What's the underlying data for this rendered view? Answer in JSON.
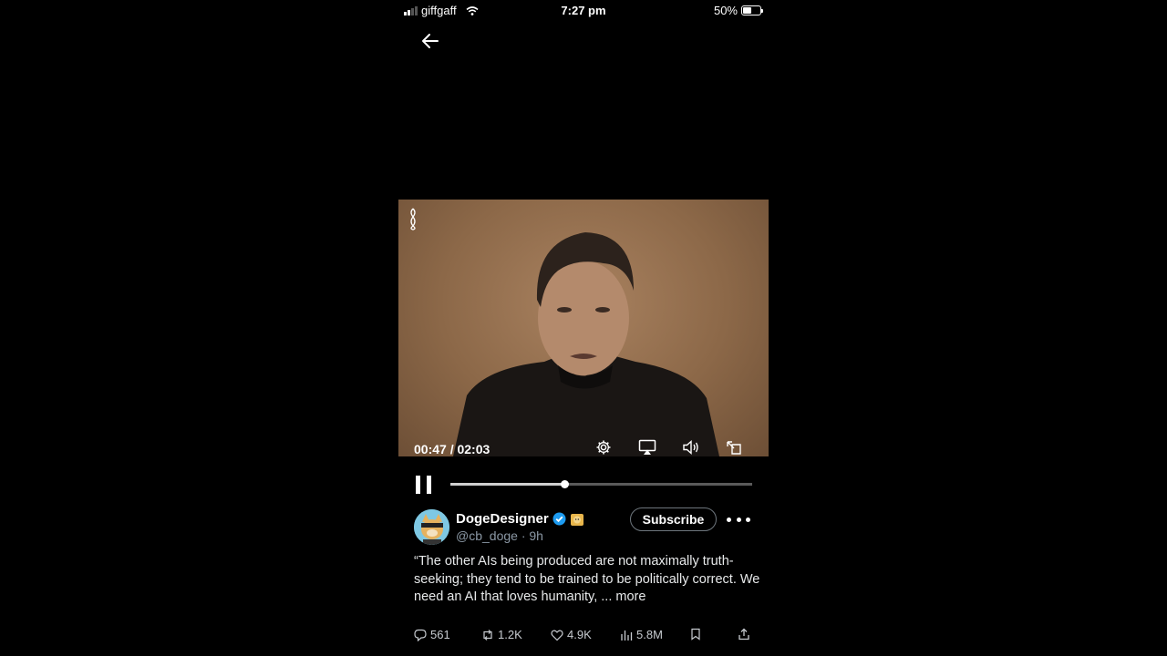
{
  "status_bar": {
    "carrier": "giffgaff",
    "time": "7:27 pm",
    "battery": "50%",
    "battery_level": 0.5
  },
  "video": {
    "current_time": "00:47",
    "separator": " / ",
    "duration": "02:03",
    "progress_fraction": 0.38,
    "controls": [
      "settings-icon",
      "airplay-icon",
      "volume-icon",
      "fullscreen-icon"
    ]
  },
  "post": {
    "author_name": "DogeDesigner",
    "handle": "@cb_doge",
    "time_ago": "9h",
    "subscribe_label": "Subscribe",
    "text": "“The other AIs being produced are not maximally truth-seeking; they tend to be trained to be politically correct. We need an AI that loves humanity, ...",
    "more_label": "more",
    "stats": {
      "replies": "561",
      "reposts": "1.2K",
      "likes": "4.9K",
      "views": "5.8M"
    }
  },
  "colors": {
    "background": "#000000",
    "verified": "#1d9bf0",
    "muted_text": "#8b98a5"
  }
}
